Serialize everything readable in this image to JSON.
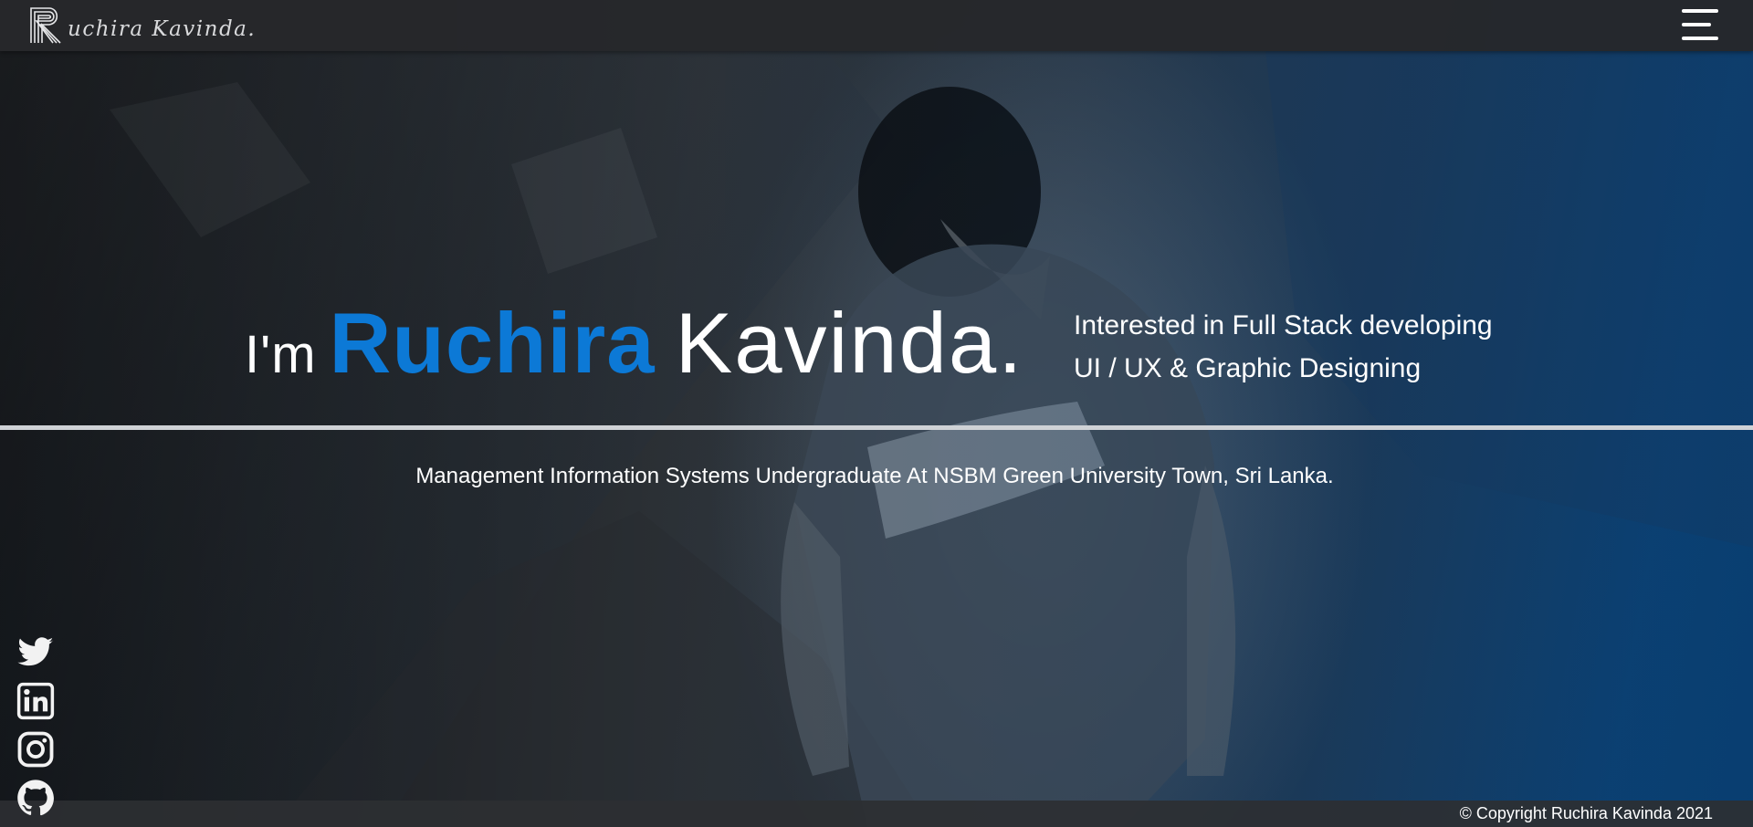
{
  "nav": {
    "brand_text": "uchira Kavinda.",
    "logo_letter": "R",
    "menu_icon": "hamburger-menu-icon"
  },
  "hero": {
    "greeting": "I'm",
    "first_name": "Ruchira",
    "last_name": "Kavinda.",
    "interests": [
      "Interested in Full Stack developing",
      "UI / UX & Graphic Designing"
    ],
    "tagline": "Management Information Systems Undergraduate At NSBM Green University Town, Sri Lanka."
  },
  "socials": [
    {
      "name": "Twitter",
      "icon": "twitter-icon"
    },
    {
      "name": "LinkedIn",
      "icon": "linkedin-icon"
    },
    {
      "name": "Instagram",
      "icon": "instagram-icon"
    },
    {
      "name": "GitHub",
      "icon": "github-icon"
    }
  ],
  "footer": {
    "copyright": "© Copyright Ruchira Kavinda 2021"
  },
  "colors": {
    "accent": "#0c79d6",
    "nav_bg": "#26282b",
    "text": "#ffffff"
  }
}
